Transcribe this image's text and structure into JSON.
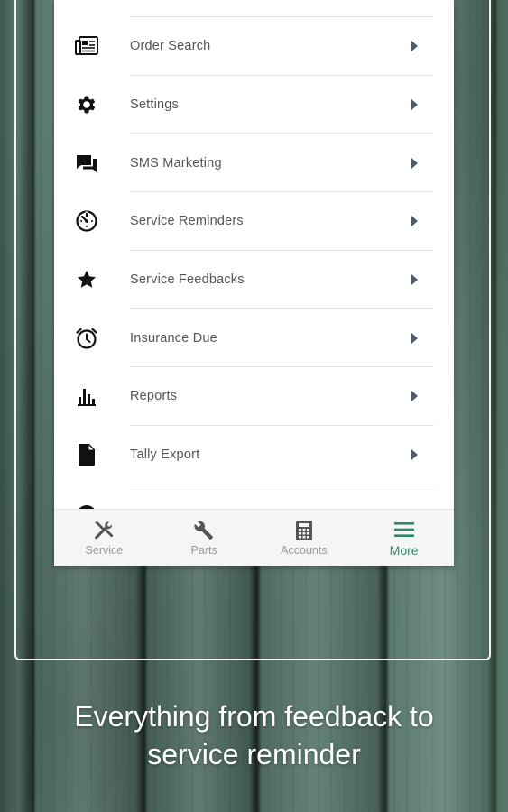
{
  "menu": {
    "items": [
      {
        "label": "Order Search",
        "icon": "order-search-icon"
      },
      {
        "label": "Settings",
        "icon": "gear-icon"
      },
      {
        "label": "SMS Marketing",
        "icon": "chat-bubbles-icon"
      },
      {
        "label": "Service Reminders",
        "icon": "timer-icon"
      },
      {
        "label": "Service Feedbacks",
        "icon": "star-icon"
      },
      {
        "label": "Insurance Due",
        "icon": "alarm-clock-icon"
      },
      {
        "label": "Reports",
        "icon": "bar-chart-icon"
      },
      {
        "label": "Tally Export",
        "icon": "document-icon"
      }
    ]
  },
  "tabs": [
    {
      "label": "Service",
      "icon": "tools-icon",
      "active": false
    },
    {
      "label": "Parts",
      "icon": "wrench-icon",
      "active": false
    },
    {
      "label": "Accounts",
      "icon": "calculator-icon",
      "active": false
    },
    {
      "label": "More",
      "icon": "menu-icon",
      "active": true
    }
  ],
  "caption": {
    "line1": "Everything from feedback to",
    "line2": "service reminder"
  },
  "colors": {
    "active_tab": "#2d8a66",
    "chevron": "#4c5c6b",
    "caption_text": "#ffffff"
  }
}
